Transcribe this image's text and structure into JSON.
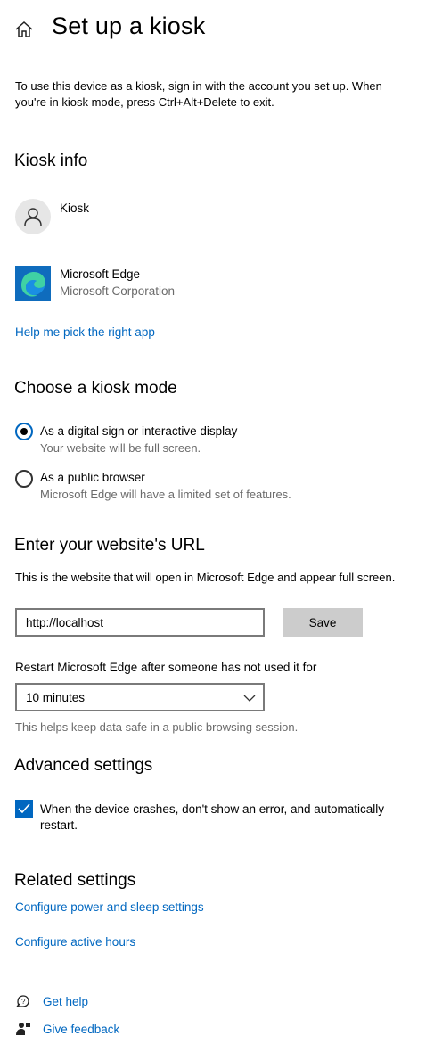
{
  "header": {
    "title": "Set up a kiosk",
    "home_icon": "home-icon"
  },
  "intro": "To use this device as a kiosk, sign in with the account you set up. When you're in kiosk mode, press Ctrl+Alt+Delete to exit.",
  "kiosk_info": {
    "heading": "Kiosk info",
    "account": {
      "name": "Kiosk",
      "icon": "person-icon"
    },
    "app": {
      "name": "Microsoft Edge",
      "publisher": "Microsoft Corporation",
      "icon": "edge-logo-icon"
    },
    "help_link": "Help me pick the right app"
  },
  "kiosk_mode": {
    "heading": "Choose a kiosk mode",
    "options": [
      {
        "label": "As a digital sign or interactive display",
        "description": "Your website will be full screen.",
        "selected": true
      },
      {
        "label": "As a public browser",
        "description": "Microsoft Edge will have a limited set of features.",
        "selected": false
      }
    ]
  },
  "url_section": {
    "heading": "Enter your website's URL",
    "description": "This is the website that will open in Microsoft Edge and appear full screen.",
    "url_value": "http://localhost",
    "save_label": "Save",
    "restart_label": "Restart Microsoft Edge after someone has not used it for",
    "restart_value": "10 minutes",
    "restart_help": "This helps keep data safe in a public browsing session."
  },
  "advanced": {
    "heading": "Advanced settings",
    "checkbox_label": "When the device crashes, don't show an error, and automatically restart.",
    "checked": true
  },
  "related": {
    "heading": "Related settings",
    "links": [
      "Configure power and sleep settings",
      "Configure active hours"
    ]
  },
  "footer": {
    "get_help": "Get help",
    "give_feedback": "Give feedback"
  },
  "colors": {
    "accent": "#0067c0",
    "secondary_text": "#6b6b6b",
    "button_bg": "#cccccc"
  }
}
